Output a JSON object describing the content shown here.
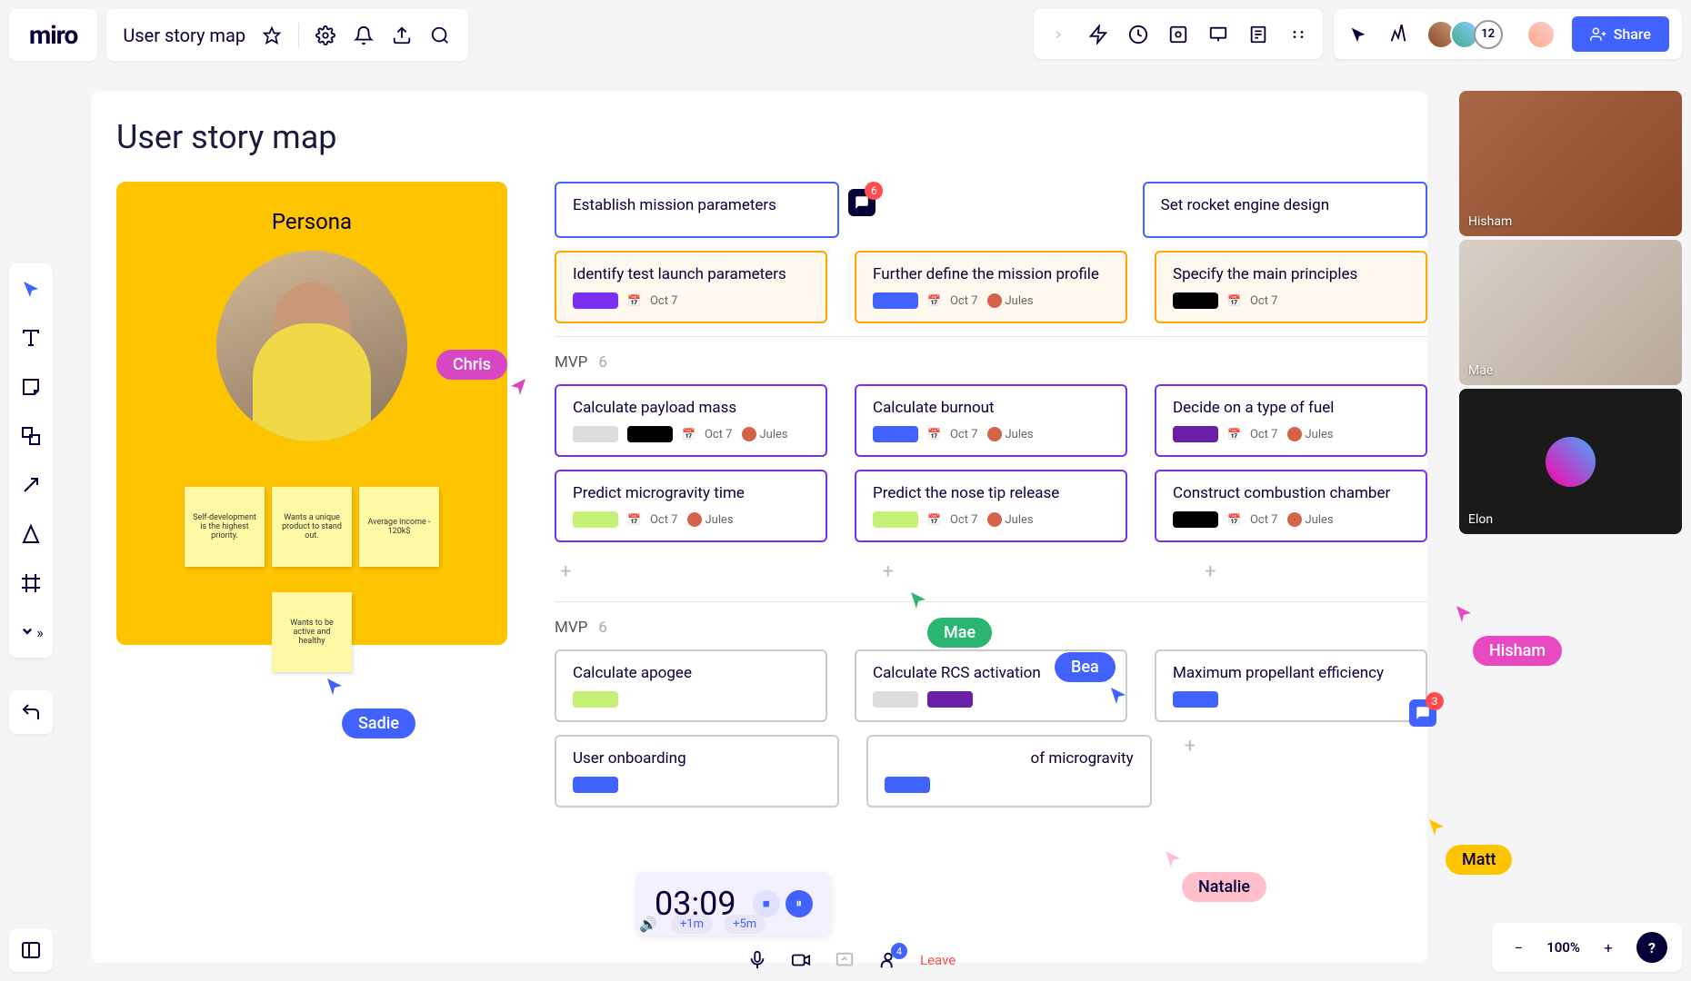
{
  "app": {
    "logo": "miro",
    "board_title": "User story map"
  },
  "share": {
    "label": "Share"
  },
  "avatar_overflow": "12",
  "canvas": {
    "title": "User story map",
    "persona": {
      "title": "Persona",
      "stickies": [
        "Self-development is the highest priority.",
        "Wants a unique product to stand out.",
        "Average income - 120k$",
        "Wants to be active and healthy"
      ]
    },
    "activities": [
      {
        "title": "Establish mission parameters"
      },
      {
        "title": "Set rocket engine design"
      }
    ],
    "row1": [
      {
        "title": "Identify test launch parameters",
        "tag": "purple",
        "date": "Oct 7"
      },
      {
        "title": "Further define the mission profile",
        "tag": "blue",
        "date": "Oct 7",
        "assignee": "Jules"
      },
      {
        "title": "Specify the main principles",
        "tag": "black",
        "date": "Oct 7"
      }
    ],
    "section1": {
      "label": "MVP",
      "count": "6"
    },
    "row2": [
      {
        "title": "Calculate payload mass",
        "tags": [
          "gray",
          "black"
        ],
        "date": "Oct 7",
        "assignee": "Jules"
      },
      {
        "title": "Calculate burnout",
        "tag": "blue",
        "date": "Oct 7",
        "assignee": "Jules"
      },
      {
        "title": "Decide on a type of fuel",
        "tag": "dpurple",
        "date": "Oct 7",
        "assignee": "Jules"
      }
    ],
    "row3": [
      {
        "title": "Predict microgravity time",
        "tag": "green",
        "date": "Oct 7",
        "assignee": "Jules"
      },
      {
        "title": "Predict the nose tip release",
        "tag": "green",
        "date": "Oct 7",
        "assignee": "Jules"
      },
      {
        "title": "Construct combustion chamber",
        "tag": "black",
        "date": "Oct 7",
        "assignee": "Jules"
      }
    ],
    "section2": {
      "label": "MVP",
      "count": "6"
    },
    "row4": [
      {
        "title": "Calculate apogee",
        "tag": "green"
      },
      {
        "title": "Calculate RCS activation",
        "tags": [
          "gray",
          "dpurple"
        ]
      },
      {
        "title": "Maximum propellant efficiency",
        "tag": "blue"
      }
    ],
    "row5": [
      {
        "title": "User onboarding",
        "tag": "blue"
      },
      {
        "title": "of microgravity",
        "tag": "blue"
      }
    ]
  },
  "cursors": {
    "chris": "Chris",
    "sadie": "Sadie",
    "mae": "Mae",
    "bea": "Bea",
    "hisham": "Hisham",
    "matt": "Matt",
    "natalie": "Natalie"
  },
  "comments": {
    "c1": "6",
    "c2": "3"
  },
  "videos": [
    {
      "name": "Hisham"
    },
    {
      "name": "Mae"
    },
    {
      "name": "Elon"
    }
  ],
  "timer": {
    "time": "03:09",
    "add1": "+1m",
    "add5": "+5m"
  },
  "bottom": {
    "people_count": "4",
    "leave": "Leave"
  },
  "zoom": {
    "value": "100%"
  }
}
